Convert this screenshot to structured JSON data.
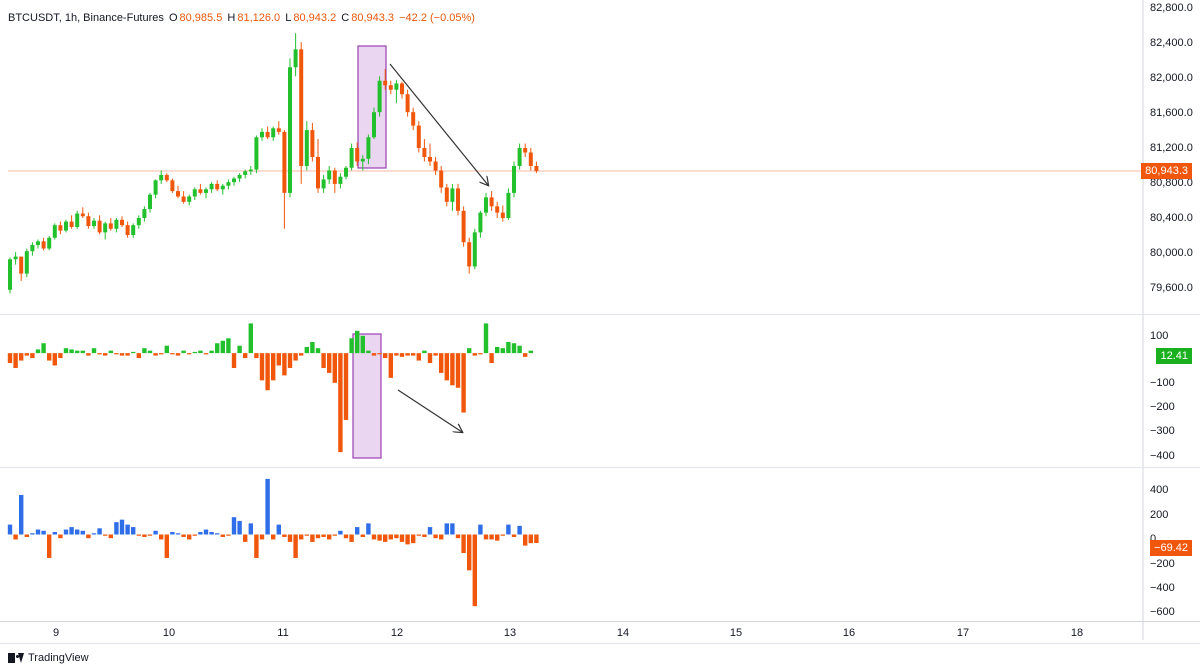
{
  "header": {
    "symbol": "BTCUSDT, 1h, Binance-Futures",
    "open_label": "O",
    "open": "80,985.5",
    "high_label": "H",
    "high": "81,126.0",
    "low_label": "L",
    "low": "80,943.2",
    "close_label": "C",
    "close": "80,943.3",
    "change": "−42.2 (−0.05%)"
  },
  "colors": {
    "up": "#22c02c",
    "down": "#f0570c",
    "delta_pos": "#2f6ee8",
    "highlight_fill": "#e8cfee",
    "highlight_stroke": "#9a3fb0",
    "price_line": "#f6b8a0"
  },
  "price_axis": {
    "ticks": [
      "82,800.0",
      "82,400.0",
      "82,000.0",
      "81,600.0",
      "81,200.0",
      "80,800.0",
      "80,400.0",
      "80,000.0",
      "79,600.0"
    ],
    "current": "80,943.3"
  },
  "indicator1_axis": {
    "ticks": [
      "100",
      "−100",
      "−200",
      "−300",
      "−400"
    ],
    "current": "12.41"
  },
  "indicator2_axis": {
    "ticks": [
      "400",
      "200",
      "0",
      "−200",
      "−400",
      "−600"
    ],
    "current": "−69.42"
  },
  "time_axis": {
    "ticks": [
      "9",
      "10",
      "11",
      "12",
      "13",
      "14",
      "15",
      "16",
      "17",
      "18"
    ]
  },
  "branding": "TradingView",
  "chart_data": [
    {
      "type": "candlestick",
      "title": "BTCUSDT, 1h, Binance-Futures",
      "xlabel": "",
      "ylabel": "",
      "x_range": [
        8.35,
        18.6
      ],
      "ylim": [
        79350,
        82850
      ],
      "current_price": 80943.3,
      "ohlc": [
        [
          79620,
          79980,
          79580,
          79960
        ],
        [
          79960,
          80040,
          79900,
          79990
        ],
        [
          79990,
          79960,
          79720,
          79800
        ],
        [
          79800,
          80080,
          79760,
          80050
        ],
        [
          80050,
          80150,
          80000,
          80120
        ],
        [
          80120,
          80180,
          80080,
          80160
        ],
        [
          80160,
          80200,
          80060,
          80080
        ],
        [
          80080,
          80220,
          80060,
          80200
        ],
        [
          80200,
          80360,
          80180,
          80340
        ],
        [
          80340,
          80380,
          80240,
          80280
        ],
        [
          80280,
          80400,
          80260,
          80380
        ],
        [
          80380,
          80450,
          80300,
          80320
        ],
        [
          80320,
          80500,
          80300,
          80470
        ],
        [
          80470,
          80540,
          80420,
          80440
        ],
        [
          80440,
          80480,
          80300,
          80330
        ],
        [
          80330,
          80420,
          80300,
          80390
        ],
        [
          80390,
          80450,
          80240,
          80260
        ],
        [
          80260,
          80380,
          80180,
          80360
        ],
        [
          80360,
          80420,
          80280,
          80300
        ],
        [
          80300,
          80420,
          80260,
          80400
        ],
        [
          80400,
          80440,
          80320,
          80340
        ],
        [
          80340,
          80380,
          80200,
          80230
        ],
        [
          80230,
          80360,
          80200,
          80340
        ],
        [
          80340,
          80450,
          80300,
          80420
        ],
        [
          80420,
          80550,
          80380,
          80520
        ],
        [
          80520,
          80700,
          80480,
          80680
        ],
        [
          80680,
          80850,
          80640,
          80840
        ],
        [
          80840,
          80950,
          80800,
          80900
        ],
        [
          80900,
          80920,
          80820,
          80840
        ],
        [
          80840,
          80860,
          80700,
          80720
        ],
        [
          80720,
          80780,
          80640,
          80660
        ],
        [
          80660,
          80720,
          80580,
          80600
        ],
        [
          80600,
          80680,
          80560,
          80660
        ],
        [
          80660,
          80760,
          80620,
          80740
        ],
        [
          80740,
          80800,
          80680,
          80700
        ],
        [
          80700,
          80760,
          80640,
          80740
        ],
        [
          80740,
          80820,
          80700,
          80800
        ],
        [
          80800,
          80840,
          80720,
          80740
        ],
        [
          80740,
          80800,
          80680,
          80780
        ],
        [
          80780,
          80850,
          80740,
          80820
        ],
        [
          80820,
          80880,
          80780,
          80860
        ],
        [
          80860,
          80920,
          80820,
          80900
        ],
        [
          80900,
          80960,
          80860,
          80940
        ],
        [
          80940,
          81000,
          80900,
          80960
        ],
        [
          80960,
          81340,
          80920,
          81320
        ],
        [
          81320,
          81420,
          81280,
          81380
        ],
        [
          81380,
          81440,
          81300,
          81320
        ],
        [
          81320,
          81440,
          81280,
          81420
        ],
        [
          81420,
          81500,
          81350,
          81380
        ],
        [
          81380,
          81400,
          80300,
          80700
        ],
        [
          80700,
          82200,
          80650,
          82100
        ],
        [
          82100,
          82480,
          82000,
          82300
        ],
        [
          82300,
          82380,
          80800,
          81000
        ],
        [
          81000,
          81500,
          80950,
          81400
        ],
        [
          81400,
          81480,
          81050,
          81100
        ],
        [
          81100,
          81300,
          80700,
          80750
        ],
        [
          80750,
          80900,
          80700,
          80850
        ],
        [
          80850,
          81000,
          80800,
          80950
        ],
        [
          80950,
          80980,
          80700,
          80800
        ],
        [
          80800,
          80920,
          80750,
          80880
        ],
        [
          80880,
          81000,
          80850,
          80980
        ],
        [
          80980,
          81250,
          80950,
          81200
        ],
        [
          81200,
          81260,
          81000,
          81050
        ],
        [
          81050,
          81120,
          80950,
          81080
        ],
        [
          81080,
          81350,
          81020,
          81320
        ],
        [
          81320,
          81650,
          81300,
          81600
        ],
        [
          81600,
          82000,
          81550,
          81950
        ],
        [
          81950,
          82080,
          81850,
          81900
        ],
        [
          81900,
          81950,
          81800,
          81850
        ],
        [
          81850,
          81960,
          81700,
          81920
        ],
        [
          81920,
          81940,
          81750,
          81800
        ],
        [
          81800,
          81850,
          81550,
          81600
        ],
        [
          81600,
          81650,
          81400,
          81450
        ],
        [
          81450,
          81500,
          81150,
          81200
        ],
        [
          81200,
          81300,
          81050,
          81100
        ],
        [
          81100,
          81250,
          81000,
          81050
        ],
        [
          81050,
          81100,
          80900,
          80950
        ],
        [
          80950,
          81000,
          80700,
          80760
        ],
        [
          80760,
          80800,
          80550,
          80600
        ],
        [
          80600,
          80800,
          80500,
          80750
        ],
        [
          80750,
          80800,
          80450,
          80500
        ],
        [
          80500,
          80550,
          80100,
          80150
        ],
        [
          80150,
          80200,
          79800,
          79880
        ],
        [
          79880,
          80300,
          79850,
          80260
        ],
        [
          80260,
          80500,
          80200,
          80480
        ],
        [
          80480,
          80700,
          80440,
          80650
        ],
        [
          80650,
          80720,
          80500,
          80550
        ],
        [
          80550,
          80600,
          80420,
          80480
        ],
        [
          80480,
          80560,
          80380,
          80420
        ],
        [
          80420,
          80750,
          80400,
          80700
        ],
        [
          80700,
          81050,
          80650,
          81000
        ],
        [
          81000,
          81250,
          80960,
          81200
        ],
        [
          81200,
          81250,
          81100,
          81150
        ],
        [
          81150,
          81200,
          80950,
          81000
        ],
        [
          81000,
          81050,
          80920,
          80943
        ]
      ]
    },
    {
      "type": "bar",
      "title": "",
      "xlabel": "",
      "ylabel": "",
      "ylim": [
        -460,
        150
      ],
      "current": 12.41,
      "values": [
        -40,
        -60,
        -30,
        -10,
        -20,
        15,
        40,
        -30,
        -50,
        -20,
        20,
        15,
        10,
        10,
        -10,
        20,
        -5,
        -10,
        10,
        -5,
        -10,
        -10,
        5,
        -20,
        20,
        10,
        -10,
        -5,
        30,
        -5,
        -10,
        10,
        -5,
        5,
        10,
        -5,
        10,
        40,
        50,
        60,
        -60,
        30,
        -20,
        120,
        -20,
        -110,
        -150,
        -110,
        -50,
        -90,
        -60,
        -30,
        -10,
        25,
        45,
        20,
        -60,
        -80,
        -120,
        -400,
        -270,
        60,
        90,
        70,
        10,
        -10,
        -5,
        -20,
        -100,
        -10,
        -15,
        -10,
        -10,
        -30,
        10,
        -40,
        -10,
        -80,
        -110,
        -130,
        -140,
        -240,
        20,
        -10,
        -5,
        120,
        -40,
        25,
        20,
        45,
        40,
        30,
        -15,
        10
      ]
    },
    {
      "type": "bar",
      "title": "",
      "xlabel": "",
      "ylabel": "",
      "ylim": [
        -700,
        530
      ],
      "current": -69.42,
      "values": [
        80,
        -40,
        320,
        -20,
        10,
        40,
        30,
        -190,
        20,
        -30,
        40,
        60,
        40,
        30,
        -30,
        10,
        50,
        -10,
        -30,
        100,
        120,
        80,
        60,
        -10,
        -20,
        -10,
        30,
        -40,
        -190,
        20,
        10,
        -20,
        -40,
        -10,
        20,
        40,
        20,
        10,
        -20,
        -10,
        140,
        110,
        -60,
        90,
        -190,
        -40,
        450,
        -40,
        80,
        -20,
        -60,
        -190,
        -40,
        -10,
        -60,
        -30,
        -20,
        -40,
        -10,
        30,
        -30,
        -60,
        60,
        -20,
        90,
        -40,
        -50,
        -60,
        -40,
        -30,
        -60,
        -80,
        -70,
        -10,
        -20,
        60,
        -30,
        -40,
        90,
        90,
        -30,
        -150,
        -290,
        -580,
        80,
        -40,
        -40,
        -50,
        -10,
        80,
        -20,
        70,
        -90,
        -70,
        -69
      ]
    }
  ]
}
